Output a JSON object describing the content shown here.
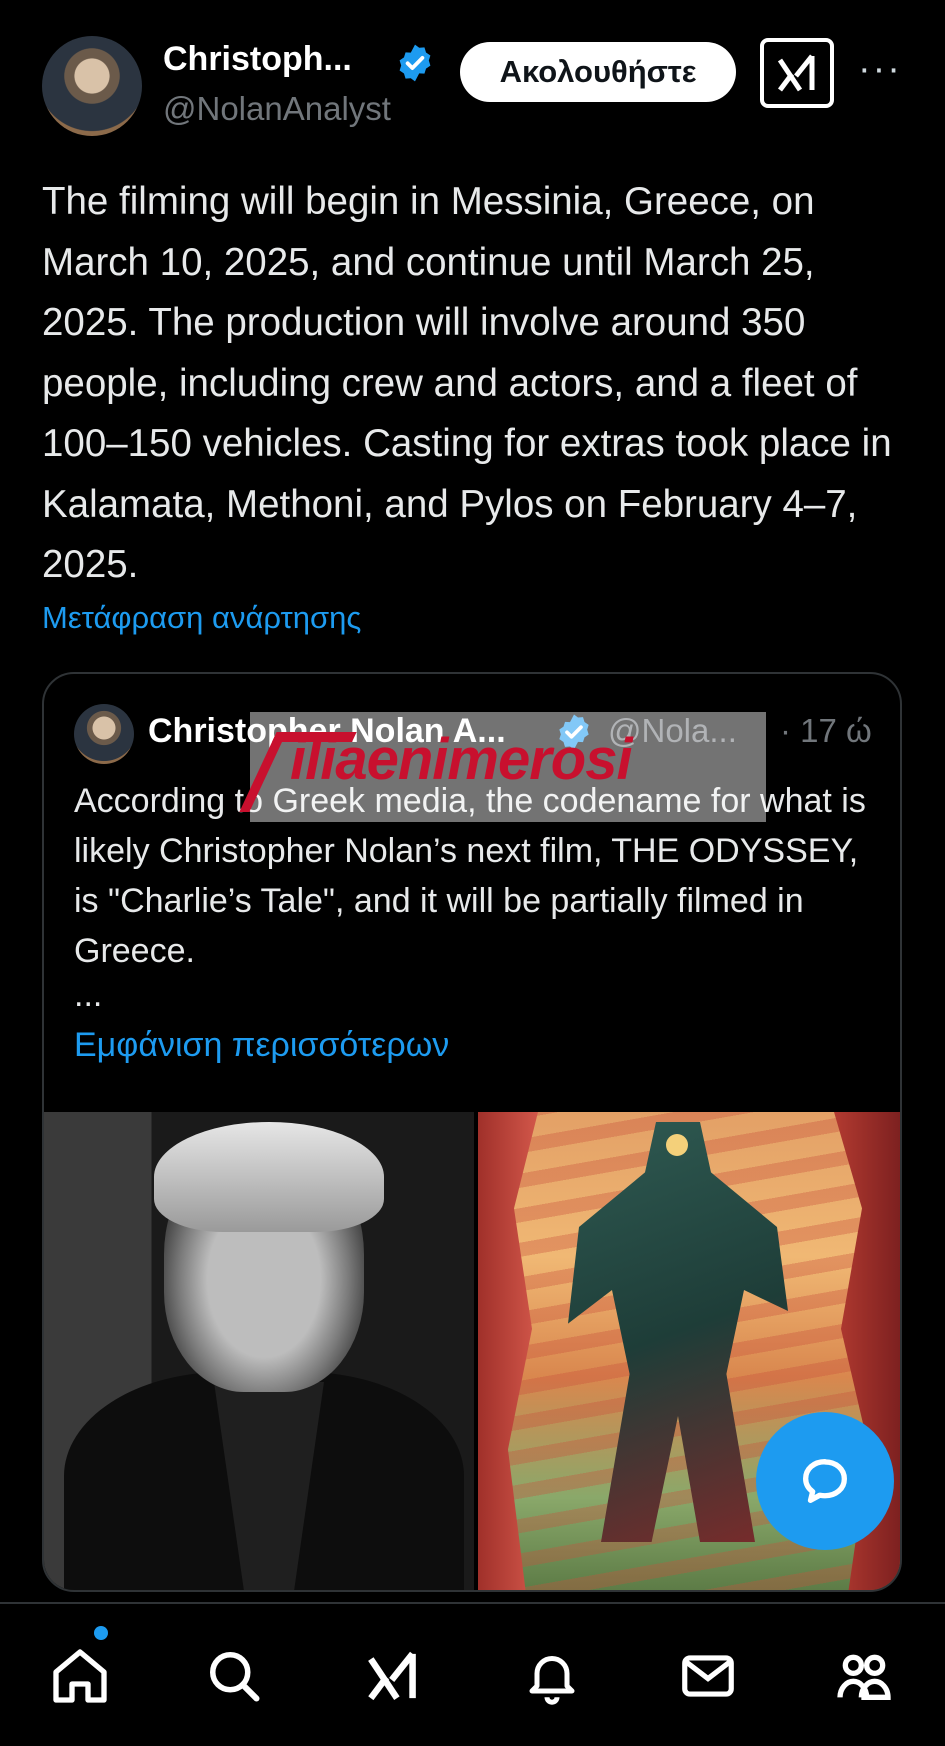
{
  "post": {
    "author_name": "Christoph...",
    "author_handle": "@NolanAnalyst",
    "follow_label": "Ακολουθήστε",
    "more_label": "···",
    "text": "The filming will begin in Messinia, Greece, on March 10, 2025, and continue until March 25, 2025. The production will involve around 350 people, including crew and actors, and a fleet of 100–150 vehicles. Casting for extras took place in Kalamata, Methoni, and Pylos on February 4–7, 2025.",
    "translate_label": "Μετάφραση ανάρτησης"
  },
  "quote": {
    "author_name": "Christopher Nolan A...",
    "author_handle": "@Nola...",
    "time": "· 17 ώ",
    "text": "According to Greek media, the codename for what is likely Christopher Nolan’s next film, THE ODYSSEY, is \"Charlie’s Tale\", and it will be partially filmed in Greece.",
    "ellipsis": "...",
    "show_more_label": "Εμφάνιση περισσότερων"
  },
  "watermark": {
    "text": "iliaenimerosi"
  },
  "icons": {
    "verified": "verified-badge-icon",
    "grok": "grok-icon",
    "fab": "reply-bubble-icon",
    "nav": [
      "home-icon",
      "search-icon",
      "grok-icon",
      "notifications-icon",
      "messages-icon",
      "communities-icon"
    ]
  },
  "colors": {
    "accent": "#1d9bf0",
    "background": "#000000",
    "secondary_text": "#71767b",
    "watermark_red": "#c8102e"
  }
}
